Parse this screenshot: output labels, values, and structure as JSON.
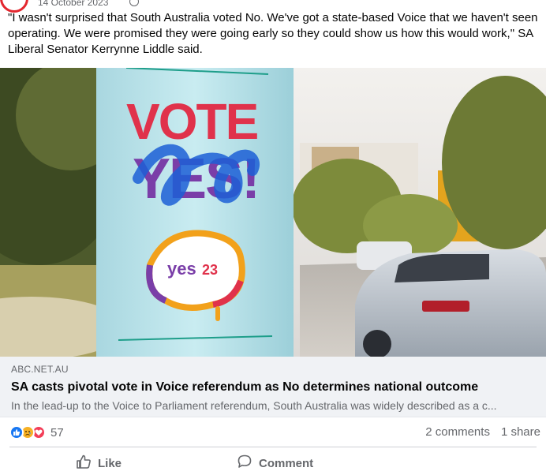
{
  "post": {
    "date": "14 October 2023",
    "text": "\"I wasn't surprised that South Australia voted No. We've got a state-based Voice that we haven't seen operating. We were promised they were going early so they could show us how this would work,\" SA Liberal Senator Kerrynne Liddle said."
  },
  "image": {
    "sign_word_1": "VOTE",
    "sign_word_2": "YES!",
    "logo_text": "yes",
    "logo_number": "23"
  },
  "link_card": {
    "domain": "ABC.NET.AU",
    "title": "SA casts pivotal vote in Voice referendum as No determines national outcome",
    "description": "In the lead-up to the Voice to Parliament referendum, South Australia was widely described as a c..."
  },
  "engagement": {
    "reaction_icons": [
      "like-icon",
      "sad-icon",
      "love-icon"
    ],
    "reaction_count": "57",
    "comments": "2 comments",
    "shares": "1 share"
  },
  "actions": {
    "like_label": "Like",
    "comment_label": "Comment"
  },
  "colors": {
    "like_blue": "#1877f2",
    "sad_yellow": "#f7b125",
    "love_red": "#f33e58",
    "link_card_bg": "#f0f2f5",
    "secondary_text": "#65676b"
  }
}
